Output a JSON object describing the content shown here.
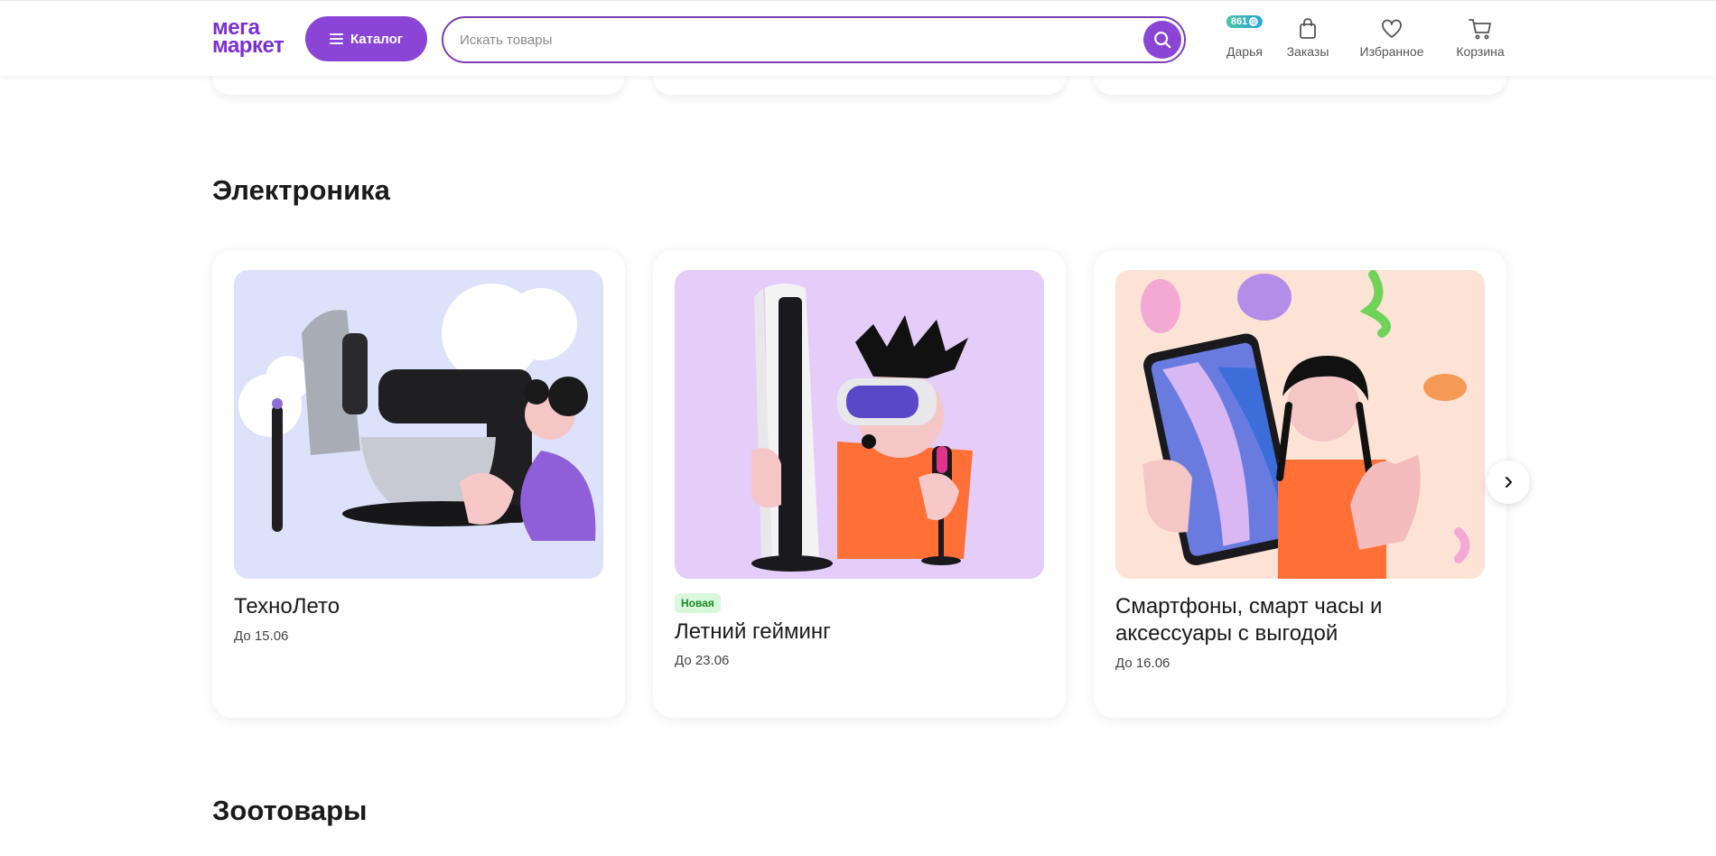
{
  "header": {
    "logo_line1": "мега",
    "logo_line2": "маркет",
    "catalog_label": "Каталог",
    "search_placeholder": "Искать товары",
    "profile": {
      "label": "Дарья",
      "bonus": "861"
    },
    "orders_label": "Заказы",
    "favorites_label": "Избранное",
    "cart_label": "Корзина"
  },
  "sections": [
    {
      "title": "Электроника",
      "cards": [
        {
          "title": "ТехноЛето",
          "date": "До 15.06",
          "tag": ""
        },
        {
          "title": "Летний гейминг",
          "date": "До 23.06",
          "tag": "Новая"
        },
        {
          "title": "Смартфоны, смарт часы и аксессуары с выгодой",
          "date": "До 16.06",
          "tag": ""
        }
      ]
    },
    {
      "title": "Зоотовары"
    }
  ],
  "colors": {
    "brand": "#8b45d6",
    "logo": "#7b2fd6",
    "new_tag_bg": "#d9f7d9",
    "new_tag_text": "#1a8a2e"
  },
  "icons": [
    "menu-icon",
    "search-icon",
    "bag-icon",
    "heart-icon",
    "cart-icon",
    "coin-icon",
    "chevron-right-icon"
  ]
}
